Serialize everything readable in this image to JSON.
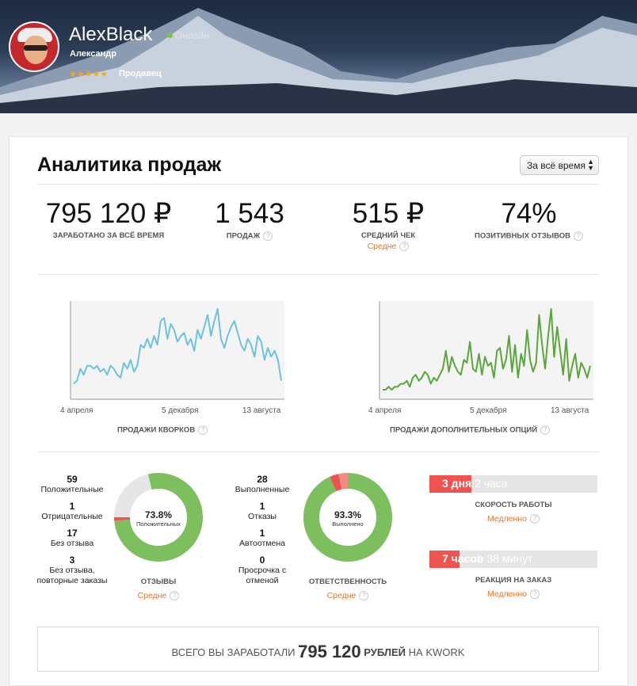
{
  "profile": {
    "username": "AlexBlack",
    "status": "Онлайн",
    "real_name": "Александр",
    "stars": "★★★★★",
    "role": "Продавец"
  },
  "analytics": {
    "title": "Аналитика продаж",
    "period": "За всё время",
    "stats": [
      {
        "value": "795 120 ₽",
        "label": "ЗАРАБОТАНО ЗА ВСЁ ВРЕМЯ"
      },
      {
        "value": "1 543",
        "label": "ПРОДАЖ"
      },
      {
        "value": "515 ₽",
        "label": "СРЕДНИЙ ЧЕК",
        "sub": "Средне"
      },
      {
        "value": "74%",
        "label": "ПОЗИТИВНЫХ ОТЗЫВОВ"
      }
    ]
  },
  "chart_data": [
    {
      "type": "line",
      "xlabel": "ПРОДАЖИ КВОРКОВ",
      "x_ticks": [
        "4 апреля",
        "5 декабря",
        "13 августа"
      ],
      "color": "#6cc3de",
      "values": [
        2,
        3,
        7,
        5,
        8,
        8,
        7,
        8,
        6,
        7,
        5,
        8,
        7,
        5,
        4,
        9,
        7,
        10,
        6,
        8,
        15,
        14,
        17,
        14,
        18,
        15,
        23,
        24,
        17,
        22,
        20,
        16,
        18,
        19,
        15,
        17,
        13,
        20,
        17,
        21,
        25,
        18,
        23,
        27,
        17,
        14,
        18,
        21,
        23,
        19,
        15,
        13,
        17,
        15,
        11,
        18,
        16,
        10,
        14,
        11,
        13,
        10,
        3
      ]
    },
    {
      "type": "line",
      "xlabel": "ПРОДАЖИ ДОПОЛНИТЕЛЬНЫХ ОПЦИЙ",
      "x_ticks": [
        "4 апреля",
        "5 декабря",
        "13 августа"
      ],
      "color": "#5aa63a",
      "values": [
        0,
        0,
        1,
        0,
        1,
        1,
        2,
        2,
        3,
        1,
        4,
        5,
        3,
        4,
        6,
        5,
        2,
        4,
        3,
        5,
        7,
        13,
        6,
        11,
        8,
        6,
        5,
        10,
        9,
        16,
        7,
        6,
        12,
        5,
        11,
        8,
        9,
        4,
        13,
        14,
        7,
        10,
        18,
        6,
        15,
        4,
        12,
        8,
        20,
        10,
        6,
        9,
        25,
        15,
        7,
        18,
        27,
        11,
        21,
        13,
        5,
        17,
        3,
        8,
        12,
        4,
        9,
        7,
        4,
        8
      ]
    }
  ],
  "reviews": {
    "legend": [
      {
        "n": "59",
        "t": "Положительные"
      },
      {
        "n": "1",
        "t": "Отрицательные"
      },
      {
        "n": "17",
        "t": "Без отзыва"
      },
      {
        "n": "3",
        "t": "Без отзыва, повторные заказы"
      }
    ],
    "percent": "73.8%",
    "center_label": "Положительных",
    "label": "ОТЗЫВЫ",
    "sub": "Средне",
    "slices": [
      59,
      1,
      17,
      3
    ],
    "colors": [
      "#7dbf5f",
      "#ef5350",
      "#e6e6e6",
      "#7dbf5f"
    ]
  },
  "responsibility": {
    "legend": [
      {
        "n": "28",
        "t": "Выполненные"
      },
      {
        "n": "1",
        "t": "Отказы"
      },
      {
        "n": "1",
        "t": "Автоотмена"
      },
      {
        "n": "0",
        "t": "Просрочка с отменой"
      }
    ],
    "percent": "93.3%",
    "center_label": "Выполнено",
    "label": "ОТВЕТСТВЕННОСТЬ",
    "sub": "Средне",
    "slices": [
      28,
      1,
      1,
      0
    ],
    "colors": [
      "#7dbf5f",
      "#ef5350",
      "#f28b82",
      "#e57373"
    ]
  },
  "speed": {
    "value_bold": "3 дня",
    "value_rest": "2 часа",
    "label": "СКОРОСТЬ РАБОТЫ",
    "sub": "Медленно",
    "fill_fraction": 0.25
  },
  "reaction": {
    "value_bold": "7 часов",
    "value_rest": "38 минут",
    "label": "РЕАКЦИЯ НА ЗАКАЗ",
    "sub": "Медленно",
    "fill_fraction": 0.18
  },
  "total": {
    "prefix": "ВСЕГО ВЫ ЗАРАБОТАЛИ",
    "amount": "795 120",
    "unit": "РУБЛЕЙ",
    "suffix": "НА KWORK"
  }
}
